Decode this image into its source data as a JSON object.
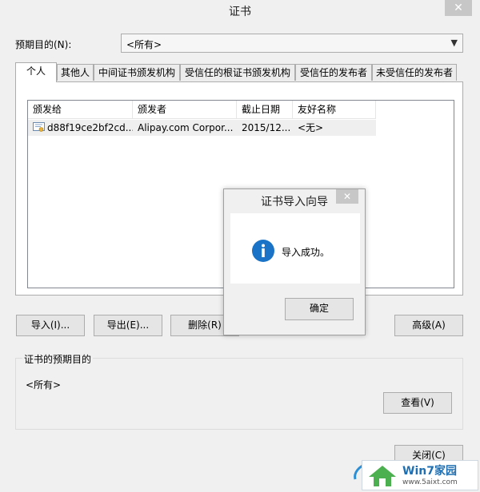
{
  "window": {
    "title": "证书",
    "close_glyph": "✕"
  },
  "purpose": {
    "label": "预期目的(N):",
    "selected": "<所有>"
  },
  "tabs": [
    {
      "label": "个人",
      "active": true
    },
    {
      "label": "其他人"
    },
    {
      "label": "中间证书颁发机构"
    },
    {
      "label": "受信任的根证书颁发机构"
    },
    {
      "label": "受信任的发布者"
    },
    {
      "label": "未受信任的发布者"
    }
  ],
  "list": {
    "columns": [
      "颁发给",
      "颁发者",
      "截止日期",
      "友好名称"
    ],
    "rows": [
      {
        "issued_to": "d88f19ce2bf2cd...",
        "issued_by": "Alipay.com Corpor...",
        "expires": "2015/12...",
        "friendly_name": "<无>"
      }
    ]
  },
  "buttons": {
    "import": "导入(I)...",
    "export": "导出(E)...",
    "delete": "删除(R)",
    "advanced": "高级(A)",
    "view": "查看(V)",
    "close": "关闭(C)"
  },
  "cert_purpose": {
    "legend": "证书的预期目的",
    "value": "<所有>"
  },
  "dialog": {
    "title": "证书导入向导",
    "message": "导入成功。",
    "ok": "确定",
    "icon": "info-icon",
    "close_glyph": "✕"
  },
  "watermark": {
    "brand": "Win7家园",
    "site": "www.5aixt.com"
  },
  "colors": {
    "info_blue": "#1a73c7",
    "brand_blue": "#1f6fb2"
  }
}
